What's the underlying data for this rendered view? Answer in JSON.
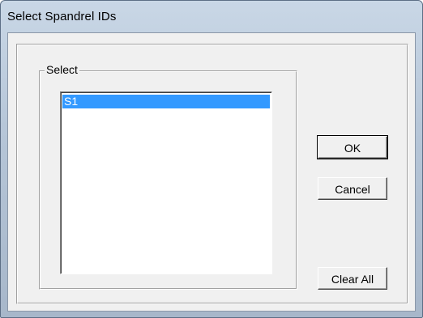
{
  "window": {
    "title": "Select Spandrel IDs"
  },
  "group": {
    "label": "Select"
  },
  "list": {
    "items": [
      {
        "label": "S1",
        "selected": true
      }
    ]
  },
  "buttons": {
    "ok_label": "OK",
    "cancel_label": "Cancel",
    "clear_all_label": "Clear All"
  },
  "colors": {
    "selection": "#3399ff",
    "dialog_face": "#f0f0f0",
    "title_bar": "#b6c6d8"
  }
}
